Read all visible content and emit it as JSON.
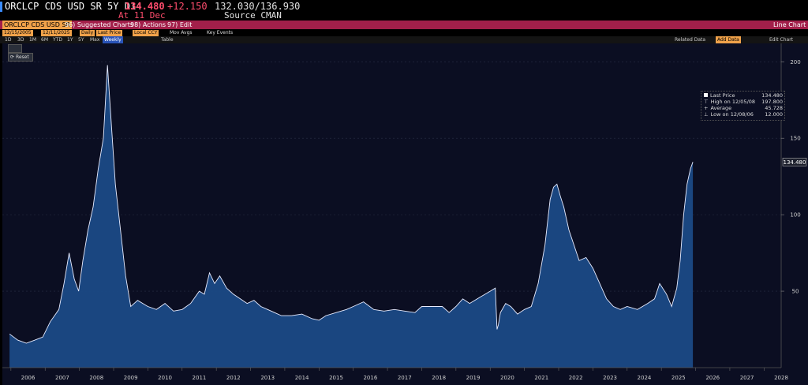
{
  "header": {
    "ticker": "ORCLCP CDS USD SR 5Y D14",
    "last_price": "134.480",
    "change": "+12.150",
    "bid_ask": "132.030/136.930",
    "date_label": "At 11 Dec",
    "source": "Source CMAN",
    "colors": {
      "price": "#ff4d6d",
      "change": "#ff4d6d",
      "text": "#ffffff",
      "accent": "#ffb100"
    }
  },
  "toolbar": {
    "security": "ORCLCP CDS USD SR",
    "suggested_charts": "96) Suggested Charts",
    "actions": "98) Actions",
    "edit": "97) Edit",
    "chart_type": "Line Chart"
  },
  "options": {
    "start_date": "12/15/2005",
    "end_date": "12/11/2025",
    "frequency": "Daily",
    "field": "Last Price",
    "currency": "Local CCY",
    "mov_avgs": "Mov Avgs",
    "key_events": "Key Events"
  },
  "periods": {
    "items": [
      "1D",
      "3D",
      "1M",
      "6M",
      "YTD",
      "1Y",
      "5Y",
      "Max"
    ],
    "interval": "Weekly",
    "table": "Table",
    "related_data": "Related Data",
    "add_data": "Add Data",
    "edit_chart": "Edit Chart"
  },
  "controls": {
    "reset": "Reset"
  },
  "legend": {
    "last_price_label": "Last Price",
    "last_price_value": "134.480",
    "high_label": "High on 12/05/08",
    "high_value": "197.800",
    "average_label": "Average",
    "average_value": "45.728",
    "low_label": "Low on 12/08/06",
    "low_value": "12.000"
  },
  "chart_data": {
    "type": "area",
    "title": "",
    "xlabel": "",
    "ylabel": "",
    "x_ticks": [
      "2006",
      "2007",
      "2008",
      "2009",
      "2010",
      "2011",
      "2012",
      "2013",
      "2014",
      "2015",
      "2016",
      "2017",
      "2018",
      "2019",
      "2020",
      "2021",
      "2022",
      "2023",
      "2024",
      "2025",
      "2026",
      "2027",
      "2028"
    ],
    "y_ticks": [
      50,
      100,
      150,
      200
    ],
    "ylim": [
      0,
      212
    ],
    "xlim": [
      2005.75,
      2028.5
    ],
    "last_value_label": "134.480",
    "colors": {
      "line": "#e8ecff",
      "fill": "#1b4a86",
      "fill_top": "#24558f",
      "background": "#0b0e22",
      "grid": "#2a2f45"
    },
    "series": [
      {
        "x": [
          2005.96,
          2006.2,
          2006.45,
          2006.7,
          2006.93,
          2007.15,
          2007.4,
          2007.55,
          2007.7,
          2007.85,
          2007.98,
          2008.1,
          2008.25,
          2008.4,
          2008.55,
          2008.7,
          2008.82,
          2008.93,
          2009.05,
          2009.2,
          2009.35,
          2009.5,
          2009.7,
          2009.85,
          2010.0,
          2010.25,
          2010.5,
          2010.75,
          2011.0,
          2011.25,
          2011.5,
          2011.65,
          2011.8,
          2011.95,
          2012.1,
          2012.3,
          2012.5,
          2012.7,
          2012.9,
          2013.1,
          2013.3,
          2013.5,
          2013.7,
          2013.9,
          2014.2,
          2014.5,
          2014.8,
          2015.0,
          2015.2,
          2015.5,
          2015.8,
          2016.0,
          2016.3,
          2016.6,
          2016.9,
          2017.2,
          2017.5,
          2017.8,
          2018.0,
          2018.3,
          2018.6,
          2018.8,
          2019.0,
          2019.2,
          2019.4,
          2019.7,
          2020.0,
          2020.15,
          2020.2,
          2020.24,
          2020.3,
          2020.45,
          2020.6,
          2020.8,
          2021.0,
          2021.2,
          2021.4,
          2021.6,
          2021.75,
          2021.85,
          2021.95,
          2022.05,
          2022.15,
          2022.3,
          2022.45,
          2022.6,
          2022.8,
          2023.0,
          2023.2,
          2023.4,
          2023.6,
          2023.8,
          2024.0,
          2024.3,
          2024.6,
          2024.8,
          2024.95,
          2025.15,
          2025.3,
          2025.45,
          2025.55,
          2025.65,
          2025.75,
          2025.85,
          2025.92
        ],
        "y": [
          22,
          18,
          16,
          18,
          20,
          30,
          38,
          55,
          75,
          58,
          50,
          70,
          90,
          105,
          130,
          150,
          197.8,
          160,
          120,
          90,
          60,
          40,
          44,
          42,
          40,
          38,
          42,
          37,
          38,
          42,
          50,
          48,
          62,
          55,
          60,
          52,
          48,
          45,
          42,
          44,
          40,
          38,
          36,
          34,
          34,
          35,
          32,
          31,
          34,
          36,
          38,
          40,
          43,
          38,
          37,
          38,
          37,
          36,
          40,
          40,
          40,
          36,
          40,
          45,
          42,
          46,
          50,
          52,
          25,
          28,
          36,
          42,
          40,
          35,
          38,
          40,
          55,
          80,
          110,
          118,
          120,
          112,
          105,
          90,
          80,
          70,
          72,
          65,
          55,
          45,
          40,
          38,
          40,
          38,
          42,
          45,
          55,
          48,
          40,
          52,
          70,
          100,
          120,
          130,
          134.48
        ]
      }
    ]
  }
}
